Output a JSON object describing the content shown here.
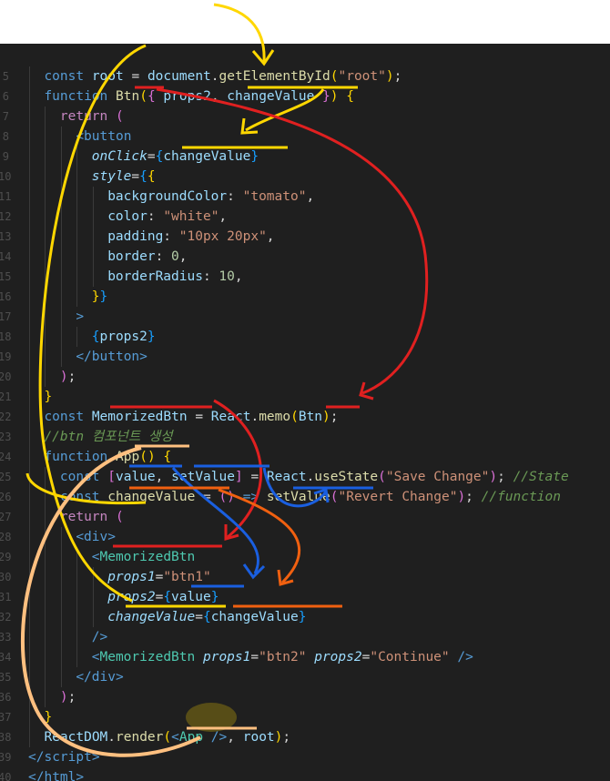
{
  "lines": [
    {
      "ln": "",
      "ind": 0,
      "t": []
    },
    {
      "ln": "5",
      "ind": 2,
      "t": [
        [
          "kw",
          "const "
        ],
        [
          "var",
          "root "
        ],
        [
          "pl",
          "= "
        ],
        [
          "var",
          "document"
        ],
        [
          "pl",
          "."
        ],
        [
          "fn",
          "getElementById"
        ],
        [
          "br1",
          "("
        ],
        [
          "str",
          "\"root\""
        ],
        [
          "br1",
          ")"
        ],
        [
          "pl",
          ";"
        ]
      ]
    },
    {
      "ln": "6",
      "ind": 2,
      "t": [
        [
          "kw",
          "function "
        ],
        [
          "fn",
          "Btn"
        ],
        [
          "br1",
          "("
        ],
        [
          "br2",
          "{ "
        ],
        [
          "var",
          "props2"
        ],
        [
          "pl",
          ", "
        ],
        [
          "var",
          "changeValue "
        ],
        [
          "br2",
          "}"
        ],
        [
          "br1",
          ") "
        ],
        [
          "br1",
          "{"
        ]
      ]
    },
    {
      "ln": "7",
      "ind": 3,
      "t": [
        [
          "kwi",
          "return "
        ],
        [
          "br2",
          "("
        ]
      ]
    },
    {
      "ln": "8",
      "ind": 4,
      "t": [
        [
          "tag",
          "<"
        ],
        [
          "tag",
          "button"
        ]
      ]
    },
    {
      "ln": "9",
      "ind": 5,
      "t": [
        [
          "attr",
          "onClick"
        ],
        [
          "pl",
          "="
        ],
        [
          "br3",
          "{"
        ],
        [
          "var",
          "changeValue"
        ],
        [
          "br3",
          "}"
        ]
      ]
    },
    {
      "ln": "10",
      "ind": 5,
      "t": [
        [
          "attr",
          "style"
        ],
        [
          "pl",
          "="
        ],
        [
          "br3",
          "{"
        ],
        [
          "br1",
          "{"
        ]
      ]
    },
    {
      "ln": "11",
      "ind": 6,
      "t": [
        [
          "prop",
          "backgroundColor"
        ],
        [
          "pl",
          ": "
        ],
        [
          "str",
          "\"tomato\""
        ],
        [
          "pl",
          ","
        ]
      ]
    },
    {
      "ln": "12",
      "ind": 6,
      "t": [
        [
          "prop",
          "color"
        ],
        [
          "pl",
          ": "
        ],
        [
          "str",
          "\"white\""
        ],
        [
          "pl",
          ","
        ]
      ]
    },
    {
      "ln": "13",
      "ind": 6,
      "t": [
        [
          "prop",
          "padding"
        ],
        [
          "pl",
          ": "
        ],
        [
          "str",
          "\"10px 20px\""
        ],
        [
          "pl",
          ","
        ]
      ]
    },
    {
      "ln": "14",
      "ind": 6,
      "t": [
        [
          "prop",
          "border"
        ],
        [
          "pl",
          ": "
        ],
        [
          "num",
          "0"
        ],
        [
          "pl",
          ","
        ]
      ]
    },
    {
      "ln": "15",
      "ind": 6,
      "t": [
        [
          "prop",
          "borderRadius"
        ],
        [
          "pl",
          ": "
        ],
        [
          "num",
          "10"
        ],
        [
          "pl",
          ","
        ]
      ]
    },
    {
      "ln": "16",
      "ind": 5,
      "t": [
        [
          "br1",
          "}"
        ],
        [
          "br3",
          "}"
        ]
      ]
    },
    {
      "ln": "17",
      "ind": 4,
      "t": [
        [
          "tag",
          ">"
        ]
      ]
    },
    {
      "ln": "18",
      "ind": 5,
      "t": [
        [
          "br3",
          "{"
        ],
        [
          "var",
          "props2"
        ],
        [
          "br3",
          "}"
        ]
      ]
    },
    {
      "ln": "19",
      "ind": 4,
      "t": [
        [
          "tag",
          "</"
        ],
        [
          "tag",
          "button"
        ],
        [
          "tag",
          ">"
        ]
      ]
    },
    {
      "ln": "20",
      "ind": 3,
      "t": [
        [
          "br2",
          ")"
        ],
        [
          "pl",
          ";"
        ]
      ]
    },
    {
      "ln": "21",
      "ind": 2,
      "t": [
        [
          "br1",
          "}"
        ]
      ]
    },
    {
      "ln": "22",
      "ind": 2,
      "t": [
        [
          "kw",
          "const "
        ],
        [
          "var",
          "MemorizedBtn "
        ],
        [
          "pl",
          "= "
        ],
        [
          "var",
          "React"
        ],
        [
          "pl",
          "."
        ],
        [
          "fn",
          "memo"
        ],
        [
          "br1",
          "("
        ],
        [
          "var",
          "Btn"
        ],
        [
          "br1",
          ")"
        ],
        [
          "pl",
          ";"
        ]
      ]
    },
    {
      "ln": "23",
      "ind": 2,
      "t": [
        [
          "cm",
          "//btn 컴포넌트 생성"
        ]
      ]
    },
    {
      "ln": "24",
      "ind": 2,
      "t": [
        [
          "kw",
          "function "
        ],
        [
          "fn",
          "App"
        ],
        [
          "br1",
          "() "
        ],
        [
          "br1",
          "{"
        ]
      ]
    },
    {
      "ln": "25",
      "ind": 3,
      "t": [
        [
          "kw",
          "const "
        ],
        [
          "br2",
          "["
        ],
        [
          "var",
          "value"
        ],
        [
          "pl",
          ", "
        ],
        [
          "var",
          "setValue"
        ],
        [
          "br2",
          "] "
        ],
        [
          "pl",
          "= "
        ],
        [
          "var",
          "React"
        ],
        [
          "pl",
          "."
        ],
        [
          "fn",
          "useState"
        ],
        [
          "br2",
          "("
        ],
        [
          "str",
          "\"Save Change\""
        ],
        [
          "br2",
          ")"
        ],
        [
          "pl",
          "; "
        ],
        [
          "cm",
          "//State"
        ]
      ]
    },
    {
      "ln": "26",
      "ind": 3,
      "t": [
        [
          "kw",
          "const "
        ],
        [
          "fn",
          "changeValue "
        ],
        [
          "pl",
          "= "
        ],
        [
          "br2",
          "() "
        ],
        [
          "kw",
          "=> "
        ],
        [
          "fn",
          "setValue"
        ],
        [
          "br2",
          "("
        ],
        [
          "str",
          "\"Revert Change\""
        ],
        [
          "br2",
          ")"
        ],
        [
          "pl",
          "; "
        ],
        [
          "cm",
          "//function"
        ]
      ]
    },
    {
      "ln": "27",
      "ind": 3,
      "t": [
        [
          "kwi",
          "return "
        ],
        [
          "br2",
          "("
        ]
      ]
    },
    {
      "ln": "28",
      "ind": 4,
      "t": [
        [
          "tag",
          "<"
        ],
        [
          "tag",
          "div"
        ],
        [
          "tag",
          ">"
        ]
      ]
    },
    {
      "ln": "29",
      "ind": 5,
      "t": [
        [
          "tag",
          "<"
        ],
        [
          "comp",
          "MemorizedBtn"
        ]
      ]
    },
    {
      "ln": "30",
      "ind": 6,
      "t": [
        [
          "attr",
          "props1"
        ],
        [
          "pl",
          "="
        ],
        [
          "str",
          "\"btn1\""
        ]
      ]
    },
    {
      "ln": "31",
      "ind": 6,
      "t": [
        [
          "attr",
          "props2"
        ],
        [
          "pl",
          "="
        ],
        [
          "br3",
          "{"
        ],
        [
          "var",
          "value"
        ],
        [
          "br3",
          "}"
        ]
      ]
    },
    {
      "ln": "32",
      "ind": 6,
      "t": [
        [
          "attr",
          "changeValue"
        ],
        [
          "pl",
          "="
        ],
        [
          "br3",
          "{"
        ],
        [
          "var",
          "changeValue"
        ],
        [
          "br3",
          "}"
        ]
      ]
    },
    {
      "ln": "33",
      "ind": 5,
      "t": [
        [
          "tag",
          "/>"
        ]
      ]
    },
    {
      "ln": "34",
      "ind": 5,
      "t": [
        [
          "tag",
          "<"
        ],
        [
          "comp",
          "MemorizedBtn "
        ],
        [
          "attr",
          "props1"
        ],
        [
          "pl",
          "="
        ],
        [
          "str",
          "\"btn2\" "
        ],
        [
          "attr",
          "props2"
        ],
        [
          "pl",
          "="
        ],
        [
          "str",
          "\"Continue\" "
        ],
        [
          "tag",
          "/>"
        ]
      ]
    },
    {
      "ln": "35",
      "ind": 4,
      "t": [
        [
          "tag",
          "</"
        ],
        [
          "tag",
          "div"
        ],
        [
          "tag",
          ">"
        ]
      ]
    },
    {
      "ln": "36",
      "ind": 3,
      "t": [
        [
          "br2",
          ")"
        ],
        [
          "pl",
          ";"
        ]
      ]
    },
    {
      "ln": "37",
      "ind": 2,
      "t": [
        [
          "br1",
          "}"
        ]
      ]
    },
    {
      "ln": "38",
      "ind": 2,
      "t": [
        [
          "var",
          "ReactDOM"
        ],
        [
          "pl",
          "."
        ],
        [
          "fn",
          "render"
        ],
        [
          "br1",
          "("
        ],
        [
          "tag",
          "<"
        ],
        [
          "comp",
          "App "
        ],
        [
          "tag",
          "/>"
        ],
        [
          "pl",
          ", "
        ],
        [
          "var",
          "root"
        ],
        [
          "br1",
          ")"
        ],
        [
          "pl",
          ";"
        ]
      ]
    },
    {
      "ln": "39",
      "ind": 1,
      "t": [
        [
          "tag",
          "</"
        ],
        [
          "tag",
          "script"
        ],
        [
          "tag",
          ">"
        ]
      ]
    },
    {
      "ln": "40",
      "ind": 0,
      "t": [
        [
          "tag",
          "</"
        ],
        [
          "tag",
          "html"
        ],
        [
          "tag",
          ">"
        ]
      ]
    }
  ],
  "colors": {
    "background": "#1f1f1f",
    "annotation_yellow": "#ffd700",
    "annotation_red": "#e02020",
    "annotation_blue": "#1a5fe0",
    "annotation_orange": "#f06010",
    "annotation_peach": "#ffc080"
  }
}
